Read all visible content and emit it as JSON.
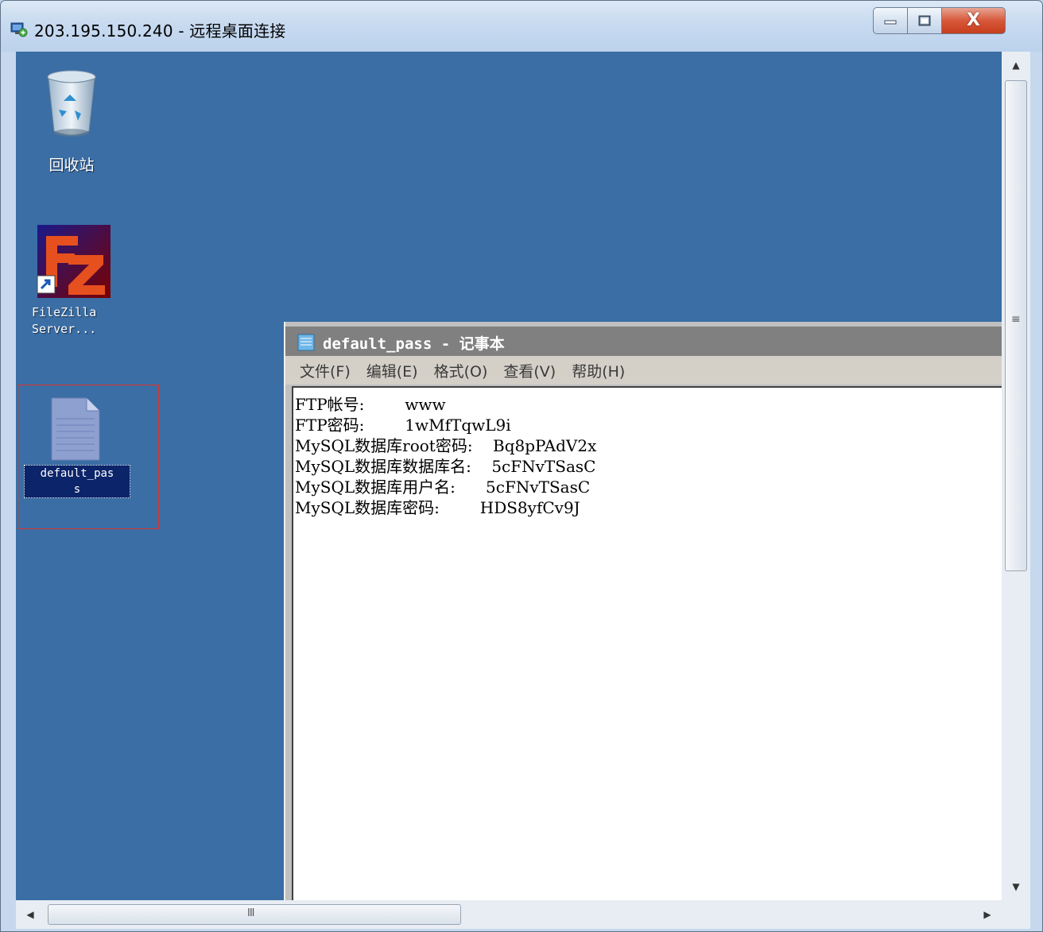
{
  "window": {
    "title": "203.195.150.240 - 远程桌面连接",
    "close_glyph": "X"
  },
  "desktop": {
    "background_color": "#3a6ea5",
    "icons": [
      {
        "label": "回收站",
        "icon": "recycle-bin-icon"
      },
      {
        "label": "FileZilla\nServer...",
        "icon": "filezilla-icon"
      },
      {
        "label": "default_pas\ns",
        "icon": "text-file-icon",
        "selected": true
      }
    ]
  },
  "notepad": {
    "title": "default_pass - 记事本",
    "menu": [
      "文件(F)",
      "编辑(E)",
      "格式(O)",
      "查看(V)",
      "帮助(H)"
    ],
    "content": "FTP帐号:        www\nFTP密码:        1wMfTqwL9i\nMySQL数据库root密码:    Bq8pPAdV2x\nMySQL数据库数据库名:    5cFNvTSasC\nMySQL数据库用户名:      5cFNvTSasC\nMySQL数据库密码:        HDS8yfCv9J"
  },
  "scrollbars": {
    "hscroll_grip": "III"
  }
}
